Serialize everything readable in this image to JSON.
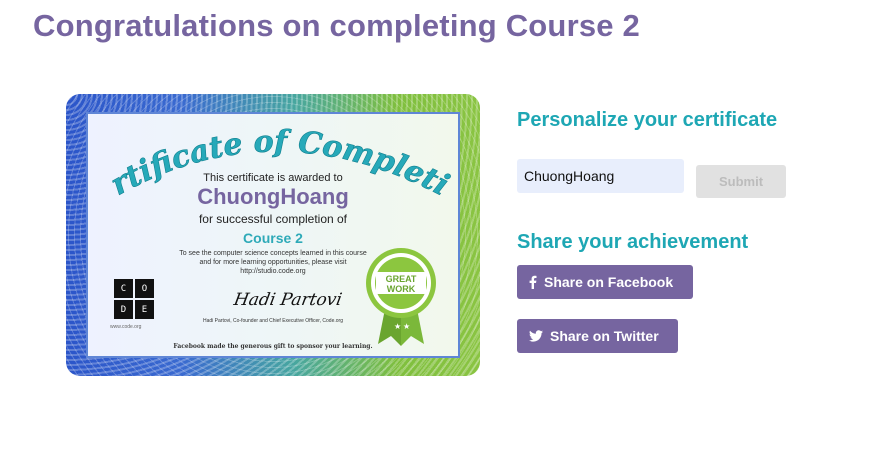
{
  "page": {
    "title": "Congratulations on completing Course 2"
  },
  "certificate": {
    "heading": "Certificate of Completion",
    "awarded_line": "This certificate is awarded to",
    "student_name": "ChuongHoang",
    "completion_line": "for successful completion of",
    "course_name": "Course 2",
    "note_line_1": "To see the computer science concepts learned in this course",
    "note_line_2": "and for more learning opportunities, please visit",
    "note_url": "http://studio.code.org",
    "logo_letters": [
      "C",
      "O",
      "D",
      "E"
    ],
    "logo_url": "www.code.org",
    "signature": "Hadi Partovi",
    "signer_line": "Hadi Partovi, Co-founder and Chief Executive Officer, Code.org",
    "sponsor_line": "Facebook made the generous gift to sponsor your learning.",
    "badge_top": "GREAT",
    "badge_bottom": "WORK",
    "colors": {
      "border_blue": "#2b55c9",
      "border_green": "#8ac442",
      "badge_green": "#8cc63f"
    }
  },
  "personalize": {
    "heading": "Personalize your certificate",
    "name_value": "ChuongHoang",
    "submit_label": "Submit"
  },
  "share": {
    "heading": "Share your achievement",
    "facebook_label": "Share on Facebook",
    "twitter_label": "Share on Twitter",
    "facebook_icon": "facebook-icon",
    "twitter_icon": "twitter-icon"
  },
  "colors": {
    "title_purple": "#7665a0",
    "heading_teal": "#1ea7b4",
    "button_purple": "#7665a0",
    "submit_disabled": "#e1e1e1",
    "input_bg": "#e8eefc"
  }
}
